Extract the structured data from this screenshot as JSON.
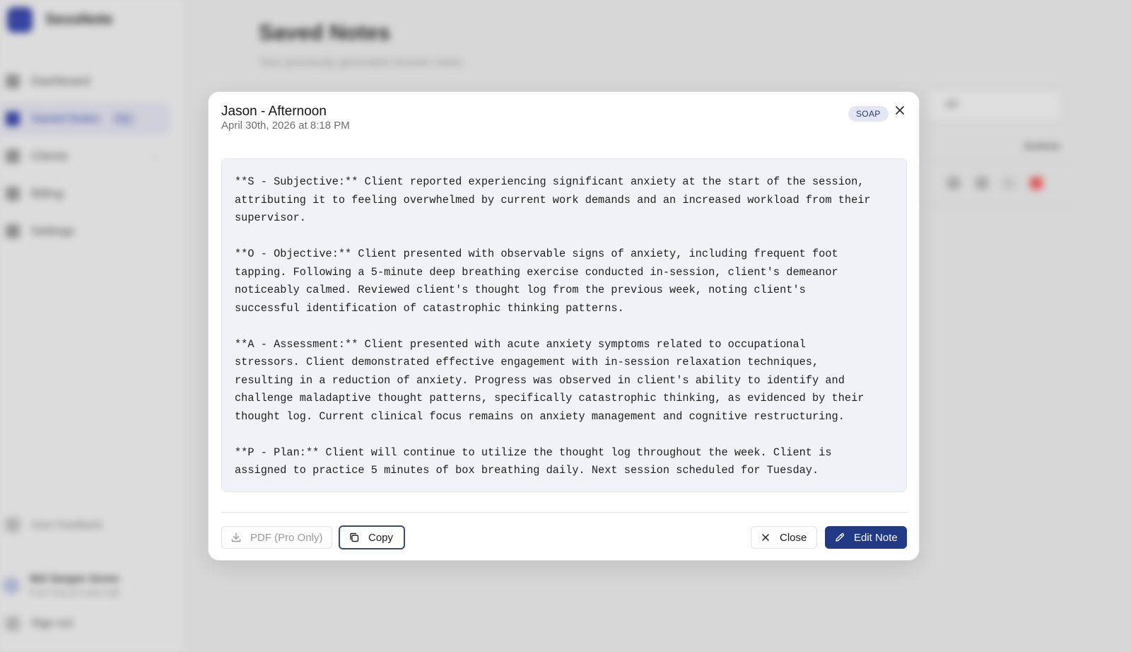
{
  "background": {
    "brand": {
      "name": "SessNote"
    },
    "nav": [
      {
        "label": "Dashboard"
      },
      {
        "label": "Saved Notes",
        "badge": "Pro"
      },
      {
        "label": "Clients"
      },
      {
        "label": "Billing"
      },
      {
        "label": "Settings"
      }
    ],
    "feedback_label": "Give Feedback",
    "user": {
      "name": "Mel Sargen Soren",
      "plan": "Free Trial (14 notes left)"
    },
    "signout_label": "Sign out",
    "page": {
      "title": "Saved Notes",
      "subtitle": "Your previously generated session notes",
      "filter_value": "All",
      "actions_header": "Actions"
    }
  },
  "modal": {
    "title": "Jason - Afternoon",
    "date": "April 30th, 2026 at 8:18 PM",
    "badge": "SOAP",
    "close_icon": "close-icon",
    "note_paragraphs": [
      "**S - Subjective:** Client reported experiencing significant anxiety at the start of the session,\nattributing it to feeling overwhelmed by current work demands and an increased workload from their\nsupervisor.",
      "**O - Objective:** Client presented with observable signs of anxiety, including frequent foot\ntapping. Following a 5-minute deep breathing exercise conducted in-session, client's demeanor\nnoticeably calmed. Reviewed client's thought log from the previous week, noting client's\nsuccessful identification of catastrophic thinking patterns.",
      "**A - Assessment:** Client presented with acute anxiety symptoms related to occupational\nstressors. Client demonstrated effective engagement with in-session relaxation techniques,\nresulting in a reduction of anxiety. Progress was observed in client's ability to identify and\nchallenge maladaptive thought patterns, specifically catastrophic thinking, as evidenced by their\nthought log. Current clinical focus remains on anxiety management and cognitive restructuring.",
      "**P - Plan:** Client will continue to utilize the thought log throughout the week. Client is\nassigned to practice 5 minutes of box breathing daily. Next session scheduled for Tuesday."
    ],
    "buttons": {
      "pdf": "PDF (Pro Only)",
      "copy": "Copy",
      "close": "Close",
      "edit": "Edit Note"
    }
  }
}
